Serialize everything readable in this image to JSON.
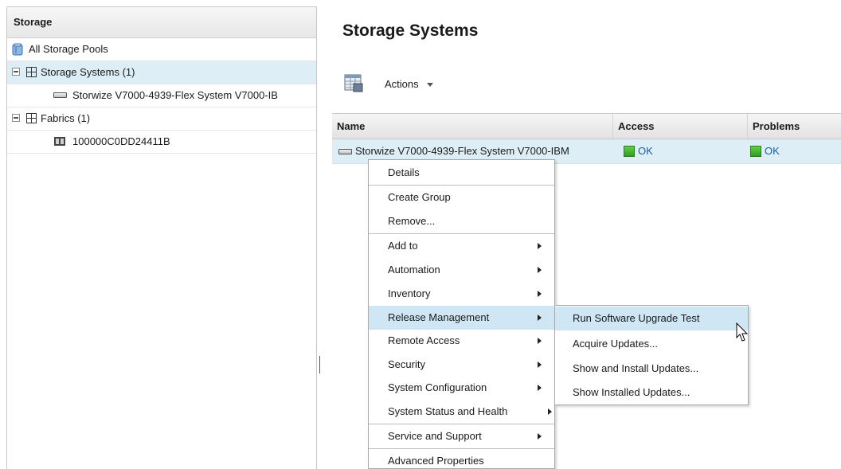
{
  "left_panel": {
    "title": "Storage",
    "all_pools": "All Storage Pools",
    "storage_systems": "Storage Systems (1)",
    "storage_system_item": "Storwize V7000-4939-Flex System V7000-IB",
    "fabrics": "Fabrics (1)",
    "fabric_item": "100000C0DD24411B"
  },
  "main": {
    "title": "Storage Systems",
    "actions_label": "Actions"
  },
  "table": {
    "columns": [
      "Name",
      "Access",
      "Problems"
    ],
    "rows": [
      {
        "name": "Storwize V7000-4939-Flex System V7000-IBM",
        "access": "OK",
        "problems": "OK"
      }
    ]
  },
  "context_menu": {
    "items": [
      "Details",
      "Create Group",
      "Remove...",
      "Add to",
      "Automation",
      "Inventory",
      "Release Management",
      "Remote Access",
      "Security",
      "System Configuration",
      "System Status and Health",
      "Service and Support",
      "Advanced Properties"
    ],
    "highlighted": "Release Management"
  },
  "submenu": {
    "items": [
      "Run Software Upgrade Test",
      "Acquire Updates...",
      "Show and Install Updates...",
      "Show Installed Updates..."
    ],
    "highlighted": "Run Software Upgrade Test"
  },
  "colors": {
    "selection": "#ddeef6",
    "menu_highlight": "#cfe6f5",
    "ok_green": "#3fb02c",
    "link_blue": "#1a5fa8"
  },
  "icons": [
    "storage-pool-icon",
    "grid-icon",
    "storage-device-icon",
    "fabric-switch-icon",
    "actions-table-icon",
    "ok-status-icon",
    "submenu-arrow-icon",
    "mouse-pointer-icon"
  ]
}
